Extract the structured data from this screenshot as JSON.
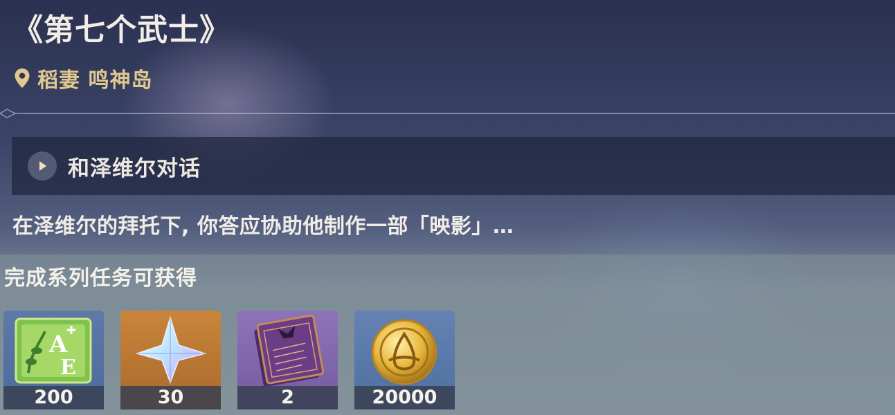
{
  "quest": {
    "title": "《第七个武士》",
    "location": "稻妻 鸣神岛",
    "objective": "和泽维尔对话",
    "description": "在泽维尔的拜托下, 你答应协助他制作一部「映影」…"
  },
  "rewards": {
    "header": "完成系列任务可获得",
    "items": [
      {
        "icon": "adventure-exp-icon",
        "count": "200"
      },
      {
        "icon": "primogem-icon",
        "count": "30"
      },
      {
        "icon": "heros-wit-book-icon",
        "count": "2"
      },
      {
        "icon": "mora-coin-icon",
        "count": "20000"
      }
    ]
  },
  "colors": {
    "location_gold": "#e1c88f",
    "panel_dark": "#20263e",
    "text_light": "#f1ede6"
  }
}
